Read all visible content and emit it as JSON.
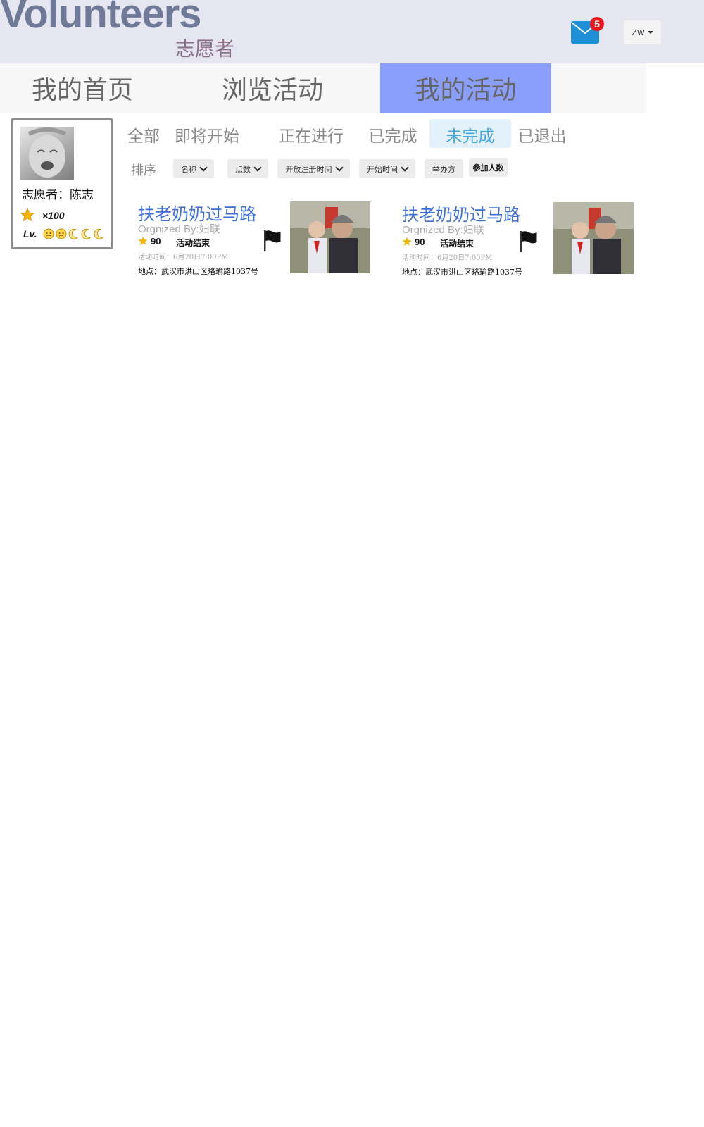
{
  "header": {
    "logo_main": "Volunteers",
    "logo_sub": "志愿者",
    "mail_count": "5",
    "lang_label": "ZW"
  },
  "nav": {
    "items": [
      {
        "label": "我的首页"
      },
      {
        "label": "浏览活动"
      },
      {
        "label": "我的活动",
        "active": true
      }
    ],
    "active_color": "#8a9ffb"
  },
  "profile": {
    "name_line": "志愿者：陈志",
    "points": "×100",
    "level_label": "Lv."
  },
  "filters": {
    "tabs": [
      {
        "label": "全部"
      },
      {
        "label": "即将开始"
      },
      {
        "label": "正在进行"
      },
      {
        "label": "已完成"
      },
      {
        "label": "未完成",
        "active": true
      },
      {
        "label": "已退出"
      }
    ]
  },
  "sort": {
    "label": "排序",
    "buttons": [
      {
        "label": "名称"
      },
      {
        "label": "点数"
      },
      {
        "label": "开放注册时间"
      },
      {
        "label": "开始时间"
      },
      {
        "label": "举办方"
      },
      {
        "label": "参加人数"
      }
    ]
  },
  "activities": [
    {
      "title": "扶老奶奶过马路",
      "org": "Orgnized By:妇联",
      "points": "90",
      "status": "活动结束",
      "time": "活动时间：6月20日7:00PM",
      "location": "地点：武汉市洪山区珞瑜路1037号"
    },
    {
      "title": "扶老奶奶过马路",
      "org": "Orgnized By:妇联",
      "points": "90",
      "status": "活动结束",
      "time": "活动时间：6月20日7:00PM",
      "location": "地点：武汉市洪山区珞瑜路1037号"
    }
  ],
  "colors": {
    "header_bg": "#e6e6f1",
    "title_blue": "#3d6ed6",
    "badge_red": "#e8151b"
  }
}
